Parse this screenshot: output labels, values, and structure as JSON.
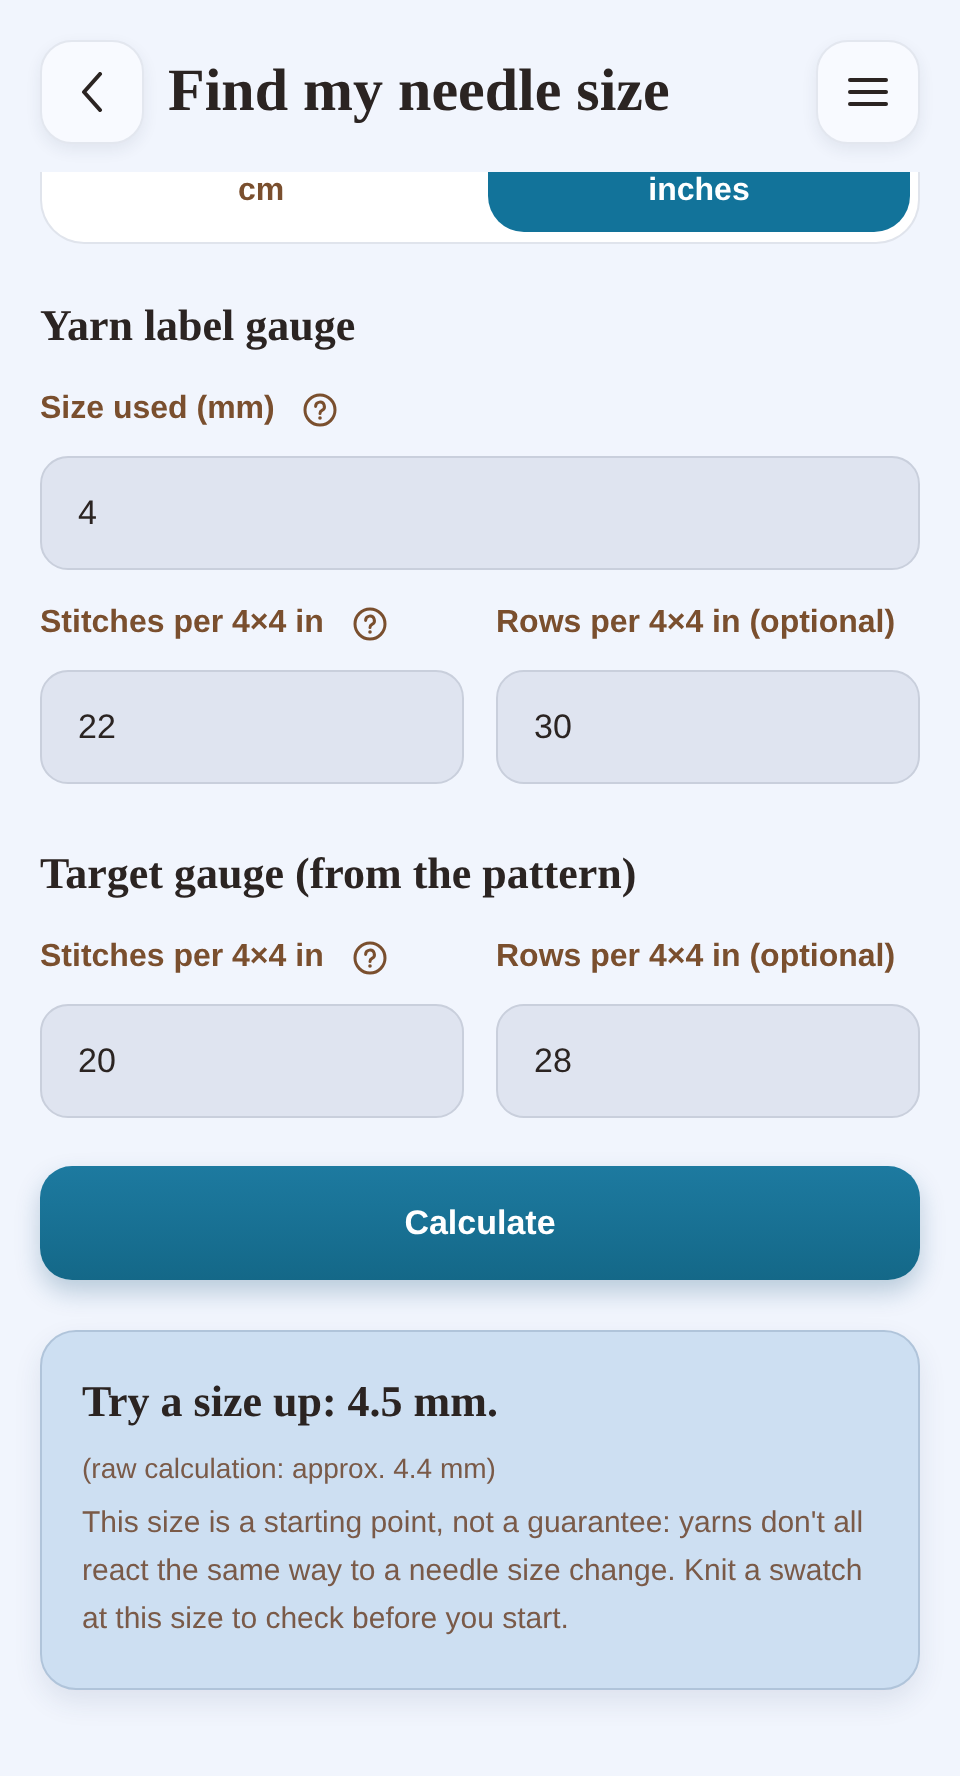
{
  "header": {
    "title": "Find my needle size"
  },
  "units": [
    {
      "label": "cm",
      "selected": false
    },
    {
      "label": "inches",
      "selected": true
    }
  ],
  "sections": [
    {
      "title": "Yarn label gauge",
      "fields": [
        {
          "label": "Size used (mm)",
          "help": true,
          "value": "4"
        }
      ],
      "rows": [
        {
          "label": "Stitches per 4×4 in",
          "help": true,
          "value": "22"
        },
        {
          "label": "Rows per 4×4 in (optional)",
          "value": "30"
        }
      ]
    },
    {
      "title": "Target gauge (from the pattern)",
      "rows": [
        {
          "label": "Stitches per 4×4 in",
          "help": true,
          "value": "20"
        },
        {
          "label": "Rows per 4×4 in (optional)",
          "value": "28"
        }
      ]
    }
  ],
  "calculate_button": "Calculate",
  "result": {
    "title": "Try a size up: 4.5 mm.",
    "raw": "(raw calculation: approx. 4.4 mm)",
    "note": "This size is a starting point, not a guarantee: yarns don't all react the same way to a needle size change. Knit a swatch at this size to check before you start."
  }
}
